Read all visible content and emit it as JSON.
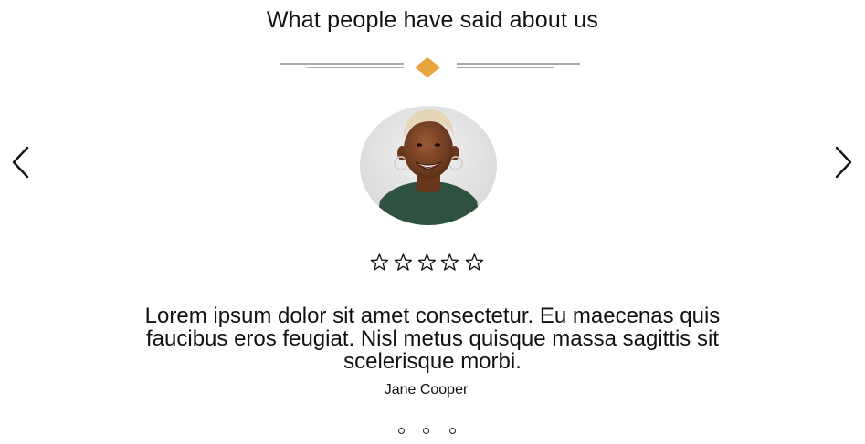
{
  "section_title": "What people have said about us",
  "testimonial": {
    "quote": "Lorem ipsum dolor sit amet consectetur. Eu maecenas quis faucibus eros feugiat. Nisl metus quisque massa sagittis sit scelerisque morbi.",
    "author": "Jane Cooper",
    "rating": 0,
    "rating_max": 5
  },
  "carousel": {
    "slide_count": 3,
    "prev_icon": "chevron-left-icon",
    "next_icon": "chevron-right-icon"
  },
  "colors": {
    "accent": "#E8A53E",
    "text": "#111111",
    "divider_line": "#555555",
    "avatar_bg": "#E9E9E9",
    "shirt": "#2F5140"
  }
}
